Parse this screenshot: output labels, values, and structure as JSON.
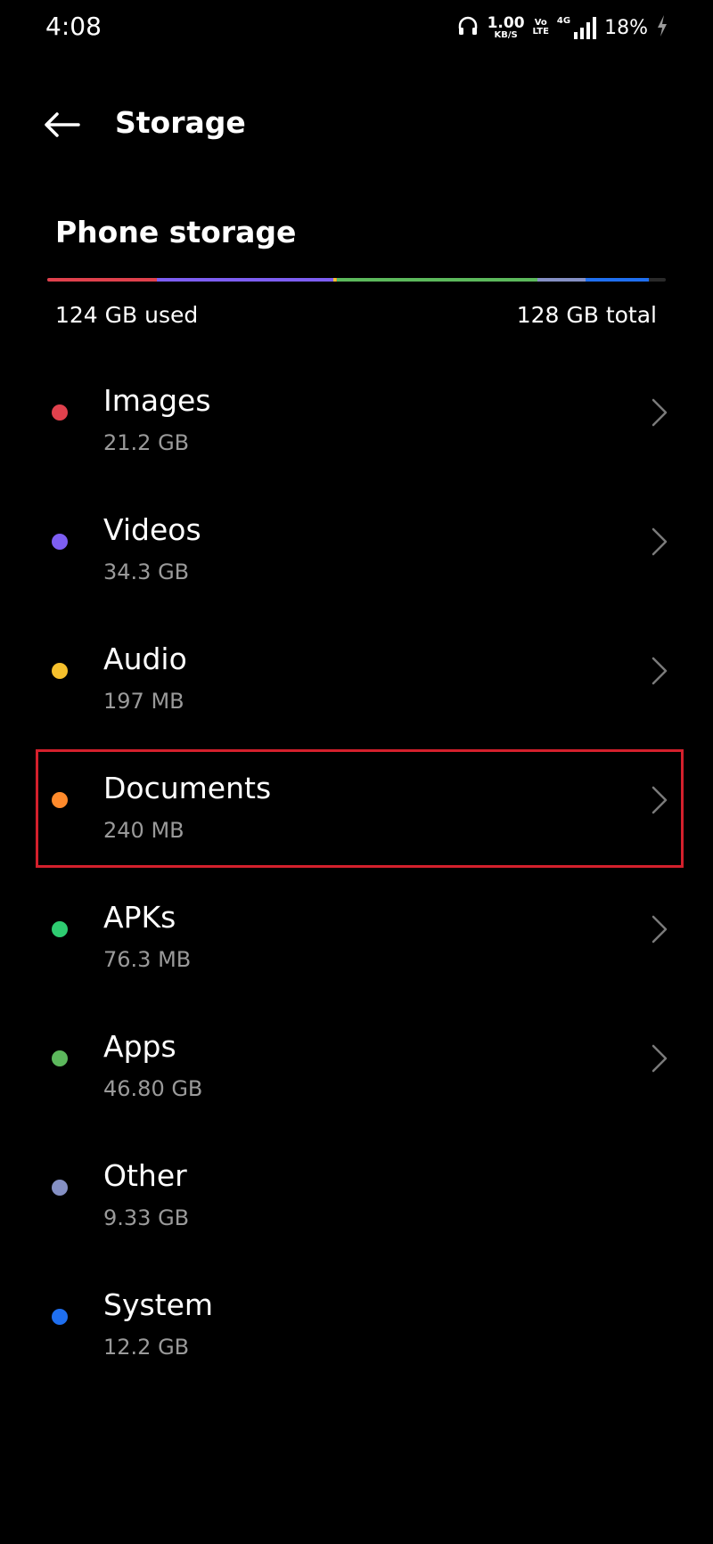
{
  "status_bar": {
    "time": "4:08",
    "speed_value": "1.00",
    "speed_unit": "KB/S",
    "volte_top": "Vo",
    "volte_bottom": "LTE",
    "network": "4G",
    "battery": "18%"
  },
  "app_bar": {
    "title": "Storage"
  },
  "storage": {
    "section_title": "Phone storage",
    "used_label": "124 GB used",
    "total_label": "128 GB total",
    "bar_segments": [
      {
        "category": "Images",
        "share": 0.177,
        "color": "#e0414d"
      },
      {
        "category": "Videos",
        "share": 0.286,
        "color": "#7d5ef2"
      },
      {
        "category": "Audio",
        "share": 0.004,
        "color": "#f6c02c"
      },
      {
        "category": "Documents",
        "share": 0.002,
        "color": "#ff8a2b"
      },
      {
        "category": "APKs",
        "share": 0.001,
        "color": "#2ecc71"
      },
      {
        "category": "Apps",
        "share": 0.323,
        "color": "#5cb85c"
      },
      {
        "category": "Other",
        "share": 0.078,
        "color": "#8590c4"
      },
      {
        "category": "System",
        "share": 0.102,
        "color": "#1f6ff0"
      }
    ]
  },
  "categories": [
    {
      "name": "Images",
      "size": "21.2 GB",
      "color": "#e0414d",
      "has_chevron": true
    },
    {
      "name": "Videos",
      "size": "34.3 GB",
      "color": "#7d5ef2",
      "has_chevron": true
    },
    {
      "name": "Audio",
      "size": "197 MB",
      "color": "#f6c02c",
      "has_chevron": true
    },
    {
      "name": "Documents",
      "size": "240 MB",
      "color": "#ff8a2b",
      "has_chevron": true,
      "highlighted": true
    },
    {
      "name": "APKs",
      "size": "76.3 MB",
      "color": "#2ecc71",
      "has_chevron": true
    },
    {
      "name": "Apps",
      "size": "46.80  GB",
      "color": "#5cb85c",
      "has_chevron": true
    },
    {
      "name": "Other",
      "size": "9.33 GB",
      "color": "#8590c4",
      "has_chevron": false
    },
    {
      "name": "System",
      "size": "12.2 GB",
      "color": "#1f6ff0",
      "has_chevron": false
    }
  ],
  "colors": {
    "highlight_border": "#d4202c",
    "secondary_text": "#9a9a9a"
  }
}
